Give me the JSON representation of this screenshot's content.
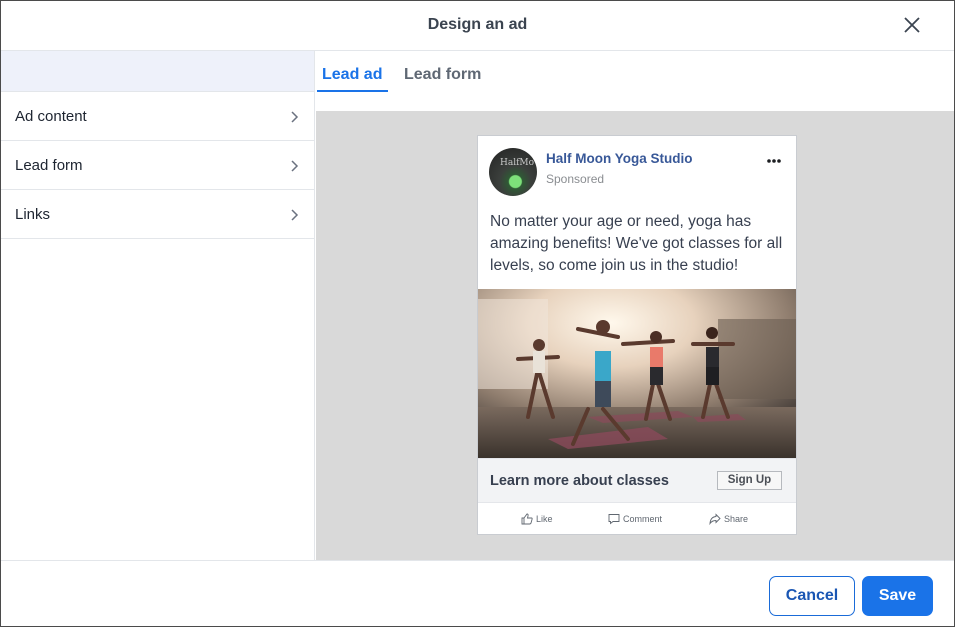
{
  "dialog": {
    "title": "Design an ad"
  },
  "sidebar": {
    "items": [
      {
        "label": "Ad content"
      },
      {
        "label": "Lead form"
      },
      {
        "label": "Links"
      }
    ]
  },
  "tabs": [
    {
      "label": "Lead ad",
      "active": true
    },
    {
      "label": "Lead form",
      "active": false
    }
  ],
  "preview": {
    "page_name": "Half Moon Yoga Studio",
    "sponsored": "Sponsored",
    "post_text": "No matter your age or need, yoga has amazing benefits! We've got classes for all levels, so come join us in the studio!",
    "cta_text": "Learn more about classes",
    "cta_button": "Sign Up",
    "actions": {
      "like": "Like",
      "comment": "Comment",
      "share": "Share"
    }
  },
  "footer": {
    "cancel": "Cancel",
    "save": "Save"
  },
  "colors": {
    "accent": "#1a73e8",
    "page_name": "#385898",
    "canvas": "#d9d9d9"
  }
}
